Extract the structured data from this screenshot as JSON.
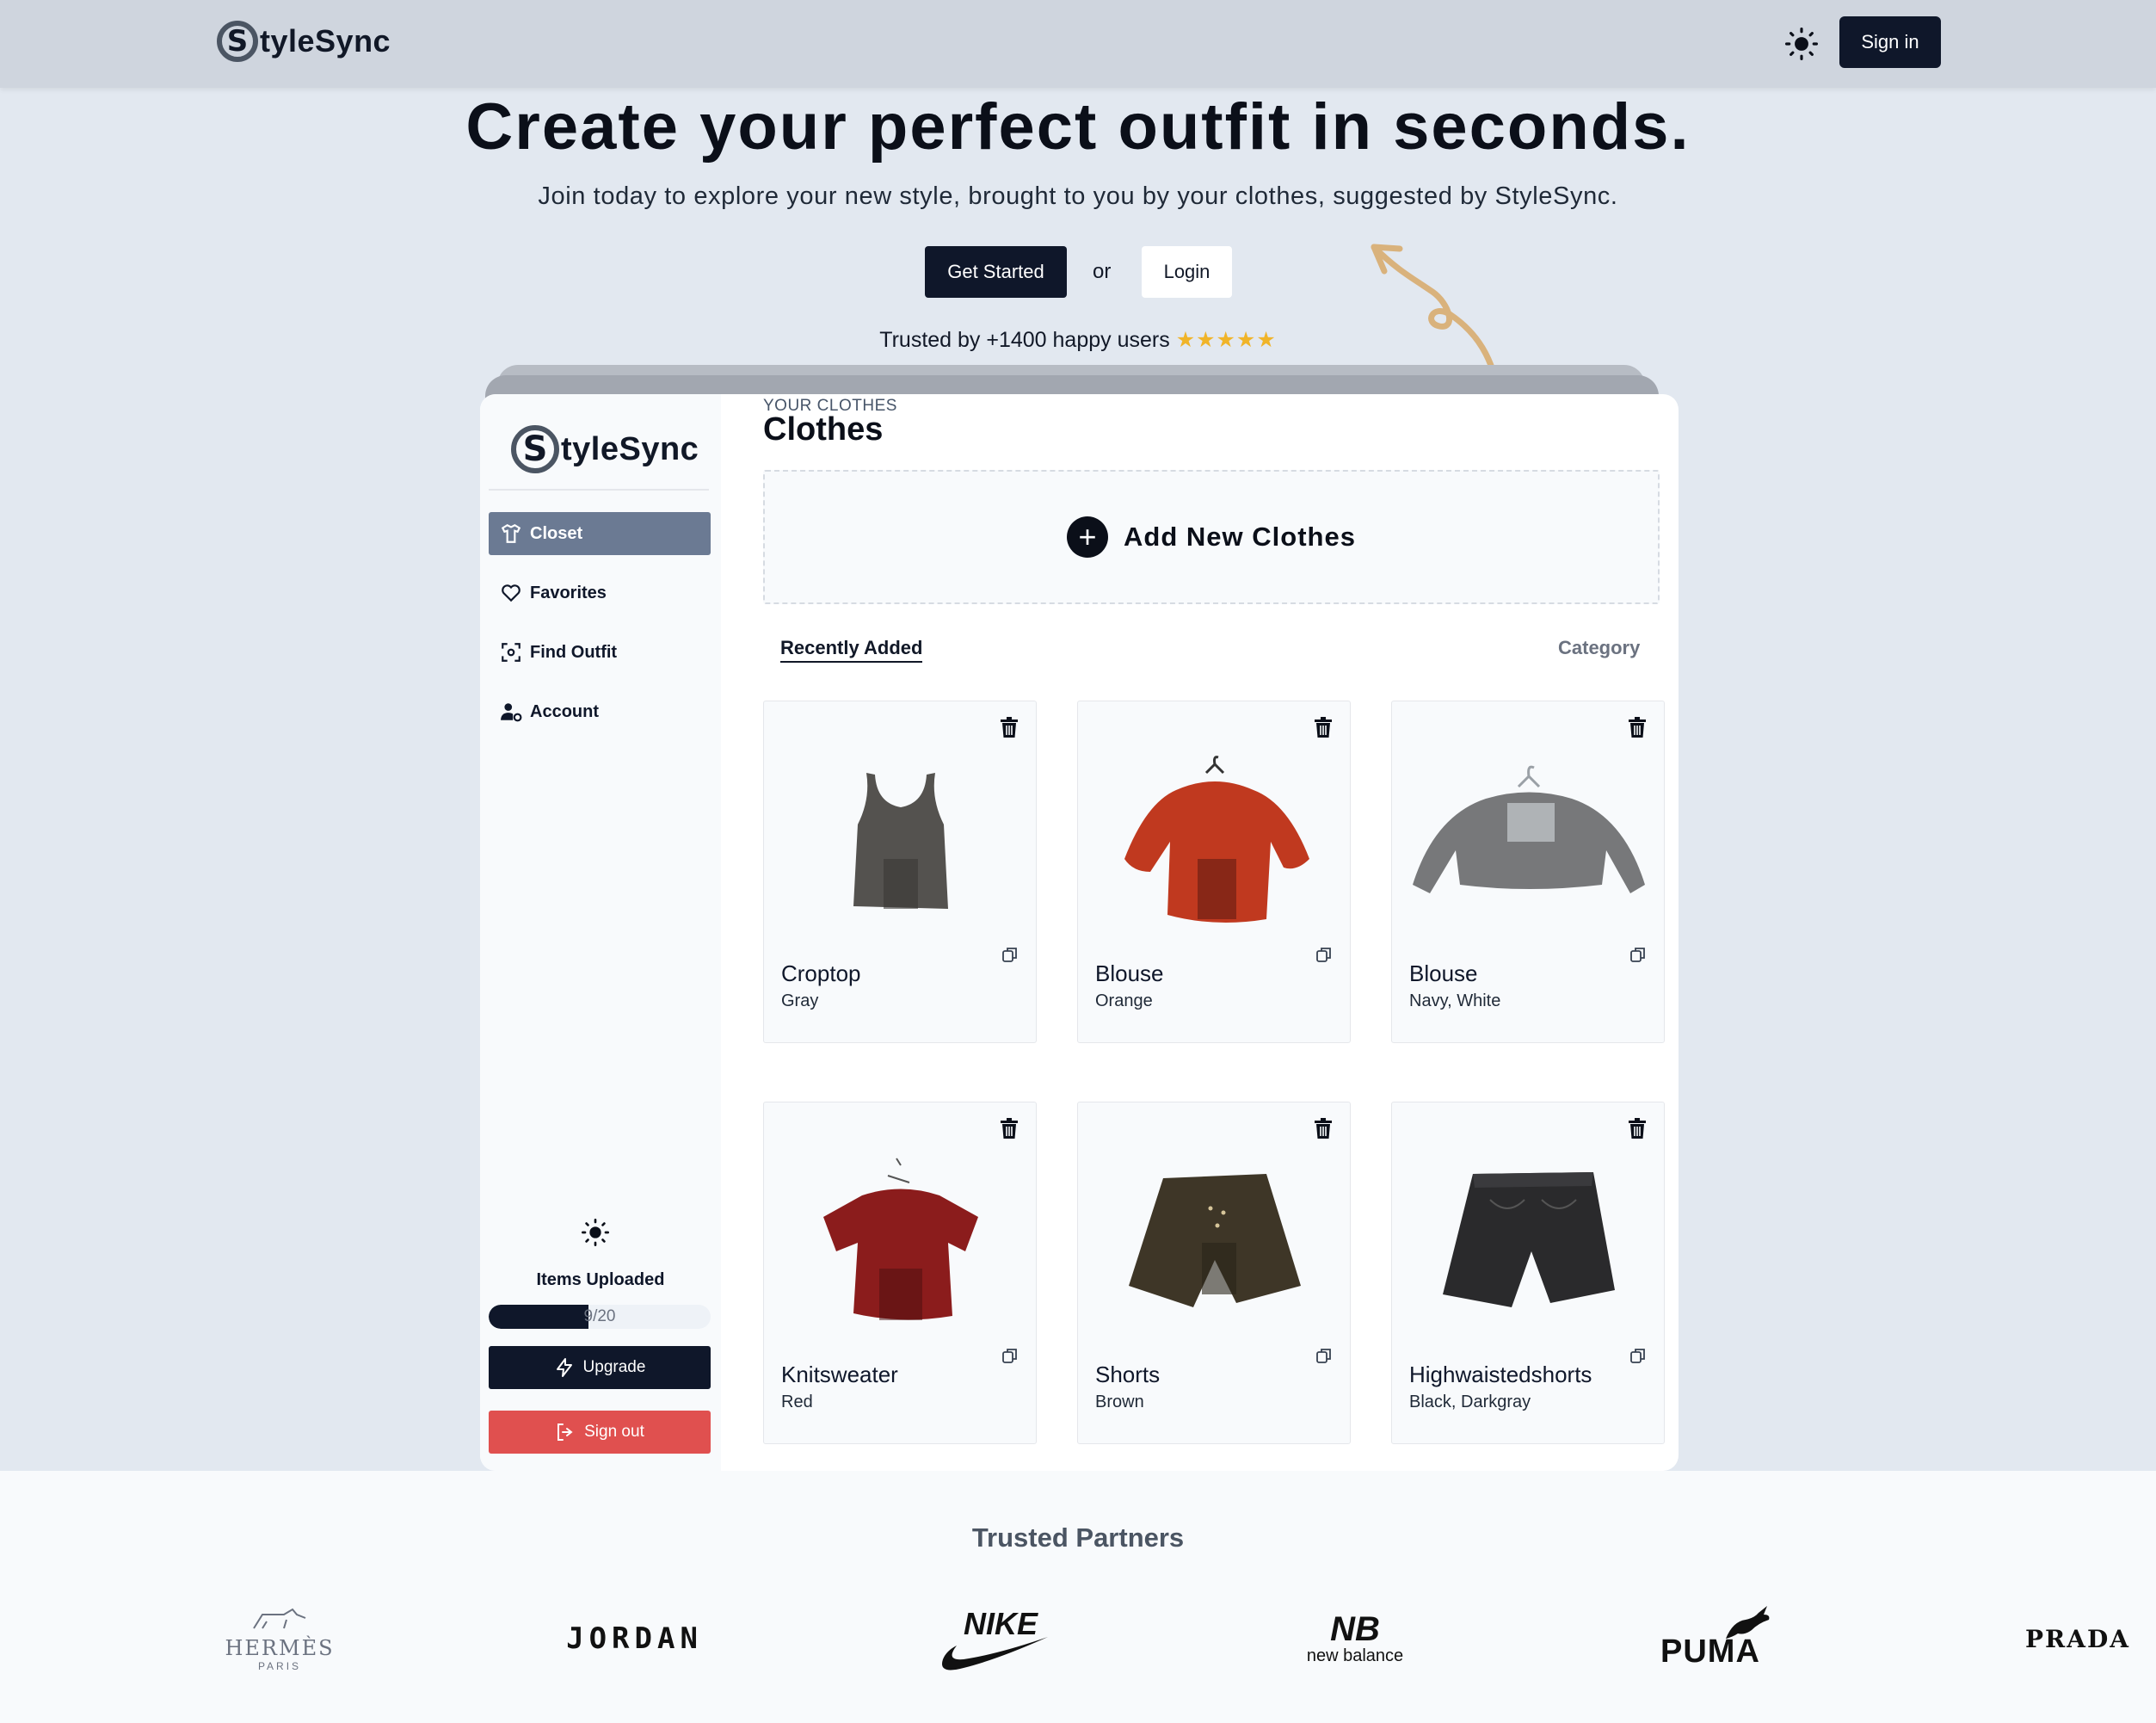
{
  "brand": {
    "name": "StyleSync",
    "s_letter": "S",
    "rest": "tyleSync"
  },
  "nav": {
    "sign_in": "Sign in",
    "theme_icon": "sun-icon"
  },
  "hero": {
    "title": "Create your perfect outfit in seconds.",
    "subtitle": "Join today to explore your new style, brought to you by your clothes, suggested by StyleSync.",
    "get_started": "Get Started",
    "or": "or",
    "login": "Login",
    "trusted": "Trusted by +1400 happy users",
    "stars": "★★★★★"
  },
  "sidebar": {
    "items": [
      {
        "label": "Closet",
        "icon": "hanger-icon",
        "active": true
      },
      {
        "label": "Favorites",
        "icon": "heart-icon",
        "active": false
      },
      {
        "label": "Find Outfit",
        "icon": "scan-icon",
        "active": false
      },
      {
        "label": "Account",
        "icon": "user-settings-icon",
        "active": false
      }
    ],
    "items_uploaded_label": "Items Uploaded",
    "upload_progress": {
      "current": 9,
      "max": 20,
      "text": "9/20"
    },
    "upgrade": "Upgrade",
    "sign_out": "Sign out"
  },
  "closet": {
    "kicker": "YOUR CLOTHES",
    "title": "Clothes",
    "add_new": "Add New Clothes",
    "tabs": {
      "recent": "Recently Added",
      "category": "Category"
    },
    "items": [
      {
        "name": "Croptop",
        "color": "Gray",
        "garment": "tank"
      },
      {
        "name": "Blouse",
        "color": "Orange",
        "garment": "blouse-orange"
      },
      {
        "name": "Blouse",
        "color": "Navy, White",
        "garment": "blouse-gray"
      },
      {
        "name": "Knitsweater",
        "color": "Red",
        "garment": "tee-red"
      },
      {
        "name": "Shorts",
        "color": "Brown",
        "garment": "shorts-brown"
      },
      {
        "name": "Highwaistedshorts",
        "color": "Black, Darkgray",
        "garment": "shorts-black"
      }
    ]
  },
  "partners": {
    "title": "Trusted Partners",
    "logos": [
      {
        "name": "HERMÈS",
        "sub": "PARIS"
      },
      {
        "name": "JORDAN"
      },
      {
        "name": "NIKE"
      },
      {
        "name": "new balance",
        "mark": "NB"
      },
      {
        "name": "PUMA"
      },
      {
        "name": "PRADA"
      }
    ]
  },
  "colors": {
    "primary": "#0f172a",
    "active_nav": "#6b7a93",
    "danger": "#e0504f",
    "star": "#f0b429",
    "arrow": "#d9b27c"
  }
}
